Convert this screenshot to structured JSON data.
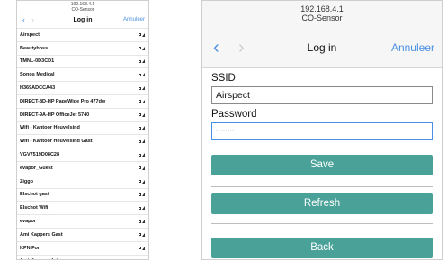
{
  "left_screen": {
    "header_ip": "192.168.4.1",
    "header_app": "CO-Sensor",
    "nav": {
      "title": "Log in",
      "cancel": "Annuleer"
    },
    "networks": [
      {
        "name": "Airspect"
      },
      {
        "name": "Beautyboss"
      },
      {
        "name": "TMNL-0D3CD1"
      },
      {
        "name": "Sonos Medical"
      },
      {
        "name": "H369ADCCA43"
      },
      {
        "name": "DIRECT-8D-HP PageWide Pro 477dw"
      },
      {
        "name": "DIRECT-9A-HP OfficeJet 5740"
      },
      {
        "name": "Wifi - Kantoor Heuvelsind"
      },
      {
        "name": "Wifi - Kantoor Heuvelsind Gast"
      },
      {
        "name": "VGV7519D08C28"
      },
      {
        "name": "evapor_Guest"
      },
      {
        "name": "Ziggo"
      },
      {
        "name": "Elschot gast"
      },
      {
        "name": "Elschot Wifi"
      },
      {
        "name": "evapor"
      },
      {
        "name": "Ami Kappers Gast"
      },
      {
        "name": "KPN Fon"
      },
      {
        "name": "Ami Kappers Intern"
      }
    ]
  },
  "right_screen": {
    "header_ip": "192.168.4.1",
    "header_app": "CO-Sensor",
    "nav": {
      "title": "Log in",
      "cancel": "Annuleer"
    },
    "ssid_label": "SSID",
    "ssid_value": "Airspect",
    "password_label": "Password",
    "password_value": "••••••••",
    "save_label": "Save",
    "refresh_label": "Refresh",
    "back_label": "Back"
  },
  "colors": {
    "accent": "#4a90e2",
    "button": "#4aa198"
  }
}
